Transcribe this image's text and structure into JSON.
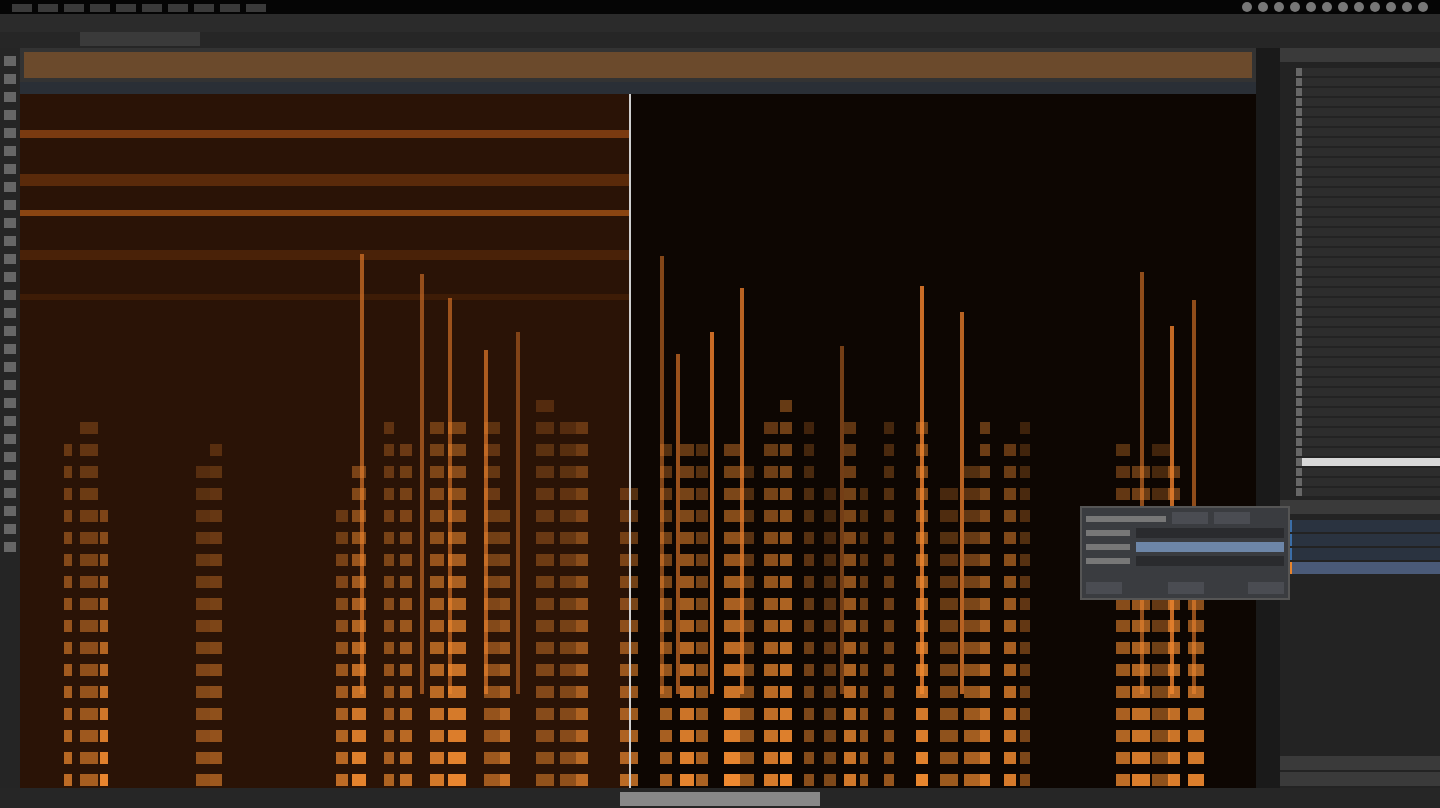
{
  "processes": [
    {
      "selected": false
    },
    {
      "selected": false
    },
    {
      "selected": false
    },
    {
      "selected": false
    },
    {
      "selected": false
    },
    {
      "selected": false
    },
    {
      "selected": false
    },
    {
      "selected": false
    },
    {
      "selected": false
    },
    {
      "selected": false
    },
    {
      "selected": false
    },
    {
      "selected": false
    },
    {
      "selected": false
    },
    {
      "selected": false
    },
    {
      "selected": false
    },
    {
      "selected": false
    },
    {
      "selected": false
    },
    {
      "selected": false
    },
    {
      "selected": false
    },
    {
      "selected": false
    },
    {
      "selected": false
    },
    {
      "selected": false
    },
    {
      "selected": false
    },
    {
      "selected": false
    },
    {
      "selected": false
    },
    {
      "selected": false
    },
    {
      "selected": false
    },
    {
      "selected": false
    },
    {
      "selected": false
    },
    {
      "selected": false
    },
    {
      "selected": false
    },
    {
      "selected": false
    },
    {
      "selected": false
    },
    {
      "selected": false
    },
    {
      "selected": false
    },
    {
      "selected": false
    },
    {
      "selected": false
    },
    {
      "selected": false
    },
    {
      "selected": false
    },
    {
      "selected": true
    },
    {
      "selected": false
    },
    {
      "selected": false
    },
    {
      "selected": false
    }
  ],
  "layers": [
    {
      "selected": false
    },
    {
      "selected": false
    },
    {
      "selected": false
    },
    {
      "selected": true
    }
  ],
  "dialog_fields": [
    {
      "selected": false
    },
    {
      "selected": true
    },
    {
      "selected": false
    }
  ]
}
